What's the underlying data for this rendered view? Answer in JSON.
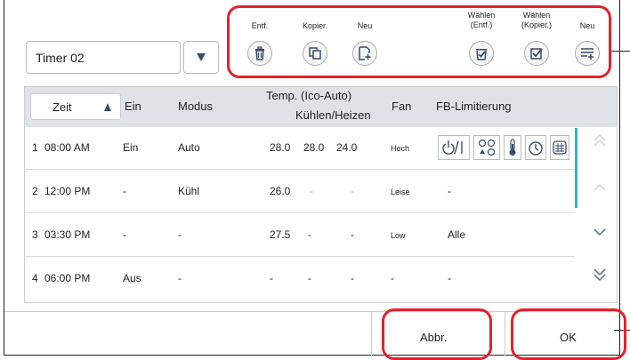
{
  "timer": {
    "selected": "Timer 02"
  },
  "toolbar": {
    "delete_label": "Entf.",
    "copy_label": "Kopier.",
    "new_label": "Neu",
    "select_delete_label": "Wählen\n(Entf.)",
    "select_copy_label": "Wählen\n(Kopier.)",
    "new_list_label": "Neu"
  },
  "table": {
    "headers": {
      "time": "Zeit",
      "on": "Ein",
      "mode": "Modus",
      "temp_line1": "Temp. (Ico-Auto)",
      "temp_line2": "Kühlen/Heizen",
      "fan": "Fan",
      "fb": "FB-Limitierung"
    },
    "rows": [
      {
        "num": "1",
        "time": "08:00 AM",
        "on": "Ein",
        "mode": "Auto",
        "t1": "28.0",
        "t2": "28.0",
        "t3": "24.0",
        "fan": "Hoch",
        "fb": ""
      },
      {
        "num": "2",
        "time": "12:00 PM",
        "on": "-",
        "mode": "Kühl",
        "t1": "26.0",
        "t2": "-",
        "t3": "-",
        "fan": "Leise",
        "fb": "-"
      },
      {
        "num": "3",
        "time": "03:30 PM",
        "on": "-",
        "mode": "-",
        "t1": "27.5",
        "t2": "-",
        "t3": "-",
        "fan": "Low",
        "fb": "Alle"
      },
      {
        "num": "4",
        "time": "06:00 PM",
        "on": "Aus",
        "mode": "-",
        "t1": "-",
        "t2": "-",
        "t3": "-",
        "fan": "-",
        "fb": "-"
      }
    ]
  },
  "buttons": {
    "cancel": "Abbr.",
    "ok": "OK"
  },
  "colors": {
    "highlight": "#e5202e",
    "icon": "#3c4c68",
    "scrollbar": "#35aee6"
  }
}
